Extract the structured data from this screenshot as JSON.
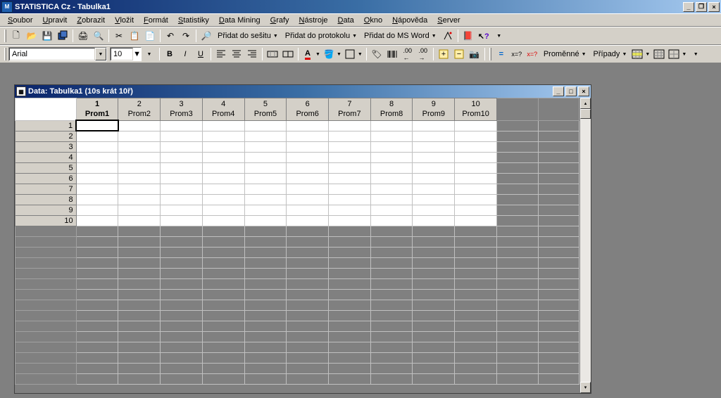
{
  "app": {
    "title": "STATISTICA Cz - Tabulka1"
  },
  "menus": [
    "Soubor",
    "Upravit",
    "Zobrazit",
    "Vložit",
    "Formát",
    "Statistiky",
    "Data Mining",
    "Grafy",
    "Nástroje",
    "Data",
    "Okno",
    "Nápověda",
    "Server"
  ],
  "toolbar1": {
    "add_to_workbook": "Přidat do sešitu",
    "add_to_protocol": "Přidat do protokolu",
    "add_to_word": "Přidat do MS Word"
  },
  "toolbar2": {
    "font_name": "Arial",
    "font_size": "10",
    "variables": "Proměnné",
    "cases": "Případy"
  },
  "child_window": {
    "title": "Data: Tabulka1 (10s krát 10ř)"
  },
  "sheet": {
    "columns": [
      {
        "num": "1",
        "name": "Prom1",
        "active": true
      },
      {
        "num": "2",
        "name": "Prom2",
        "active": false
      },
      {
        "num": "3",
        "name": "Prom3",
        "active": false
      },
      {
        "num": "4",
        "name": "Prom4",
        "active": false
      },
      {
        "num": "5",
        "name": "Prom5",
        "active": false
      },
      {
        "num": "6",
        "name": "Prom6",
        "active": false
      },
      {
        "num": "7",
        "name": "Prom7",
        "active": false
      },
      {
        "num": "8",
        "name": "Prom8",
        "active": false
      },
      {
        "num": "9",
        "name": "Prom9",
        "active": false
      },
      {
        "num": "10",
        "name": "Prom10",
        "active": false
      }
    ],
    "rows": 10,
    "selected": {
      "row": 1,
      "col": 1
    },
    "extra_cols": 2,
    "extra_rows": 15
  }
}
